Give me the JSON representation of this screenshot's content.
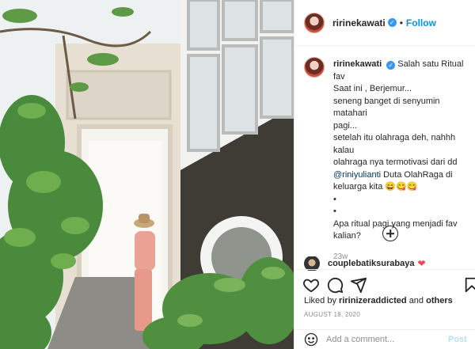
{
  "post": {
    "username": "ririnekawati",
    "follow_label": "Follow",
    "separator": "•",
    "caption_lines": [
      "Salah satu Ritual fav",
      "Saat ini , Berjemur...",
      "seneng banget di senyumin matahari",
      "pagi...",
      "setelah itu olahraga deh, nahhh kalau",
      "olahraga nya termotivasi dari dd",
      "@riniyulianti Duta OlahRaga di",
      "keluarga kita 😄😋😋",
      "•",
      "•",
      "Apa ritual pagi yang menjadi fav",
      "kalian?"
    ],
    "caption_mention": "@riniyulianti",
    "caption_time": "23w",
    "comment_preview_user": "couplebatiksurabaya",
    "comment_preview_emoji": "❤",
    "liked_by_prefix": "Liked by",
    "liked_by_user": "ririnizeraddicted",
    "liked_by_and": "and",
    "liked_by_others": "others",
    "date": "AUGUST 18, 2020",
    "comment_placeholder": "Add a comment...",
    "post_button": "Post"
  },
  "icons": {
    "verified": "verified-badge-icon",
    "like": "heart-icon",
    "comment": "comment-icon",
    "share": "paper-plane-icon",
    "save": "bookmark-icon",
    "emoji": "smiley-icon",
    "load_more": "plus-circle-icon"
  },
  "colors": {
    "link_blue": "#0095f6",
    "mention": "#00376b",
    "muted": "#8e8e8e",
    "heart_red": "#ed4956",
    "border": "#efefef"
  }
}
